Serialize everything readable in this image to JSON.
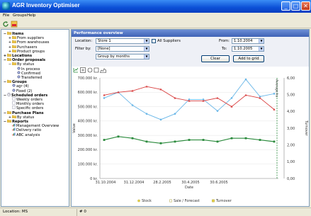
{
  "window": {
    "title": "AGR Inventory Optimiser"
  },
  "menu": [
    "File",
    "Groups",
    "Help"
  ],
  "tree": [
    {
      "label": "Items",
      "bold": true,
      "indent": 0,
      "icon": "folder-icon",
      "exp": "−"
    },
    {
      "label": "From suppliers",
      "bold": false,
      "indent": 1,
      "icon": "folder-icon",
      "exp": "+"
    },
    {
      "label": "From warehouses",
      "bold": false,
      "indent": 1,
      "icon": "folder-icon",
      "exp": "+"
    },
    {
      "label": "Purchasers",
      "bold": false,
      "indent": 1,
      "icon": "folder-icon",
      "exp": "+"
    },
    {
      "label": "Product groups",
      "bold": false,
      "indent": 1,
      "icon": "folder-icon",
      "exp": "+"
    },
    {
      "label": "Locations",
      "bold": true,
      "indent": 0,
      "icon": "folder-icon",
      "exp": "+"
    },
    {
      "label": "Order proposals",
      "bold": true,
      "indent": 0,
      "icon": "folder-icon",
      "exp": "−"
    },
    {
      "label": "By status",
      "bold": false,
      "indent": 1,
      "icon": "folder-icon",
      "exp": "−"
    },
    {
      "label": "In process",
      "bold": false,
      "indent": 2,
      "icon": "gear-icon",
      "exp": ""
    },
    {
      "label": "Confirmed",
      "bold": false,
      "indent": 2,
      "icon": "gear-icon",
      "exp": ""
    },
    {
      "label": "Transferred",
      "bold": false,
      "indent": 2,
      "icon": "gear-icon",
      "exp": ""
    },
    {
      "label": "Groups",
      "bold": true,
      "indent": 0,
      "icon": "folder-icon",
      "exp": "−"
    },
    {
      "label": "agr (4)",
      "bold": false,
      "indent": 1,
      "icon": "gear-icon",
      "exp": ""
    },
    {
      "label": "Fixed (2)",
      "bold": false,
      "indent": 1,
      "icon": "gear-icon",
      "exp": ""
    },
    {
      "label": "Scheduled orders",
      "bold": true,
      "indent": 0,
      "icon": "clock-icon",
      "exp": "−"
    },
    {
      "label": "Weekly orders",
      "bold": false,
      "indent": 1,
      "icon": "doc-icon",
      "exp": ""
    },
    {
      "label": "Monthly orders",
      "bold": false,
      "indent": 1,
      "icon": "doc-icon",
      "exp": ""
    },
    {
      "label": "Specific orders",
      "bold": false,
      "indent": 1,
      "icon": "doc-icon",
      "exp": ""
    },
    {
      "label": "Purchase Plans",
      "bold": true,
      "indent": 0,
      "icon": "folder-icon",
      "exp": "−"
    },
    {
      "label": "By status",
      "bold": false,
      "indent": 1,
      "icon": "folder-icon",
      "exp": "+"
    },
    {
      "label": "Reports",
      "bold": true,
      "indent": 0,
      "icon": "folder-icon",
      "exp": "−"
    },
    {
      "label": "Management Overview",
      "bold": false,
      "indent": 1,
      "icon": "chart-icon",
      "exp": ""
    },
    {
      "label": "Delivery ratio",
      "bold": false,
      "indent": 1,
      "icon": "chart-icon",
      "exp": ""
    },
    {
      "label": "ABC analysis",
      "bold": false,
      "indent": 1,
      "icon": "chart-icon",
      "exp": ""
    }
  ],
  "panel": {
    "title": "Performance overview"
  },
  "controls": {
    "location_label": "Location:",
    "location_value": "Store 1",
    "all_suppliers_label": "All Suppliers",
    "filter_label": "Filter by:",
    "filter_value": "[None]",
    "group_value": "Group by months",
    "from_label": "From:",
    "from_value": "1.10.2004",
    "to_label": "To:",
    "to_value": "1.10.2005",
    "clear_label": "Clear",
    "add_grid_label": "Add to grid"
  },
  "status": {
    "location": "Location: MS",
    "count": "# 0"
  },
  "colors": {
    "stock": "#6ab7e8",
    "sale": "#d94040",
    "turnover": "#2a8a3c",
    "axis": "#999999"
  },
  "chart_data": {
    "type": "line",
    "ylabel": "Value",
    "y2label": "Turnover",
    "xlabel": "Date",
    "ylim": [
      0,
      700000
    ],
    "y2lim": [
      0,
      6
    ],
    "yticks": [
      "0 kr.",
      "100.000 kr.",
      "200.000 kr.",
      "300.000 kr.",
      "400.000 kr.",
      "500.000 kr.",
      "600.000 kr.",
      "700.000 kr."
    ],
    "y2ticks": [
      "0,00",
      "1,00",
      "2,00",
      "3,00",
      "4,00",
      "5,00",
      "6,00"
    ],
    "xticks": [
      "31.10.2004",
      "31.12.2004",
      "28.2.2005",
      "30.4.2005",
      "30.6.2005"
    ],
    "annotation": "Average ku",
    "series": [
      {
        "name": "Stock",
        "axis": "left",
        "values": [
          560000,
          600000,
          510000,
          450000,
          410000,
          450000,
          550000,
          550000,
          470000,
          560000,
          690000,
          570000,
          590000
        ]
      },
      {
        "name": "Sale / Forecast",
        "axis": "left",
        "values": [
          580000,
          600000,
          610000,
          640000,
          620000,
          560000,
          540000,
          540000,
          560000,
          500000,
          580000,
          560000,
          480000
        ]
      },
      {
        "name": "Turnover",
        "axis": "right",
        "values": [
          2.3,
          2.5,
          2.4,
          2.2,
          2.1,
          2.2,
          2.3,
          2.3,
          2.2,
          2.4,
          2.4,
          2.3,
          2.2
        ]
      }
    ],
    "legend": [
      "Stock",
      "Sale / Forecast",
      "Turnover"
    ]
  }
}
